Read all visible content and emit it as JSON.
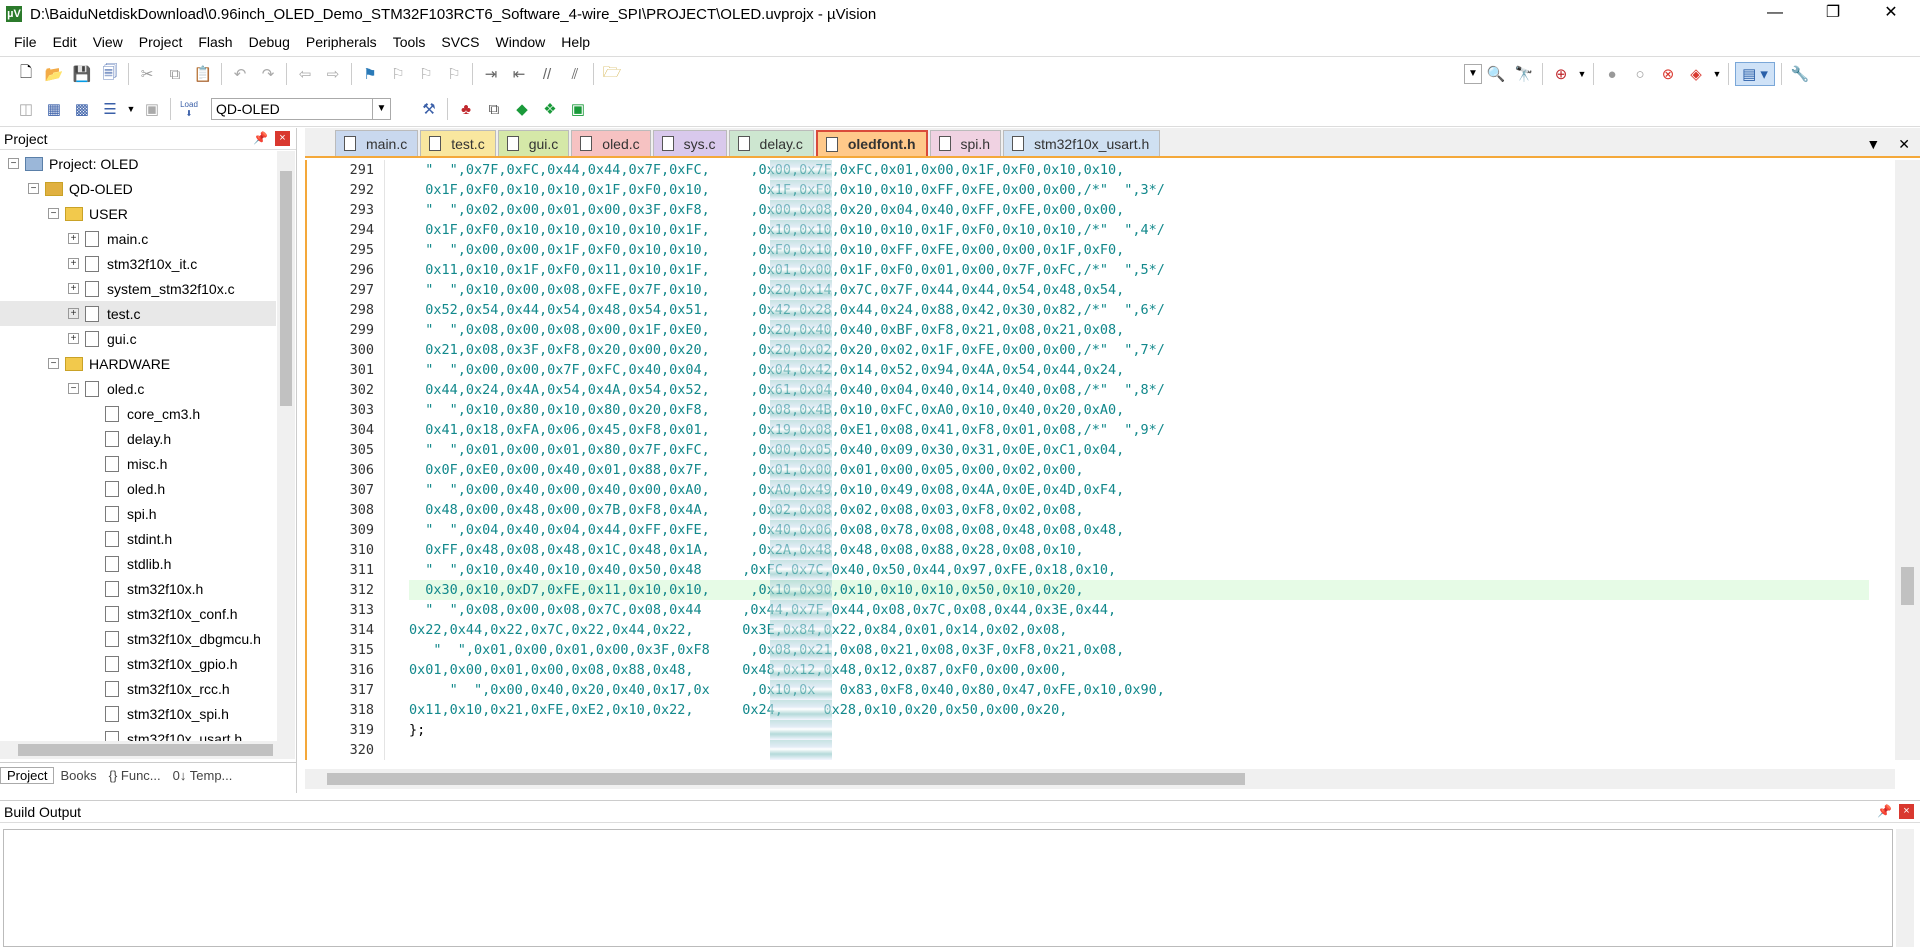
{
  "window": {
    "title": "D:\\BaiduNetdiskDownload\\0.96inch_OLED_Demo_STM32F103RCT6_Software_4-wire_SPI\\PROJECT\\OLED.uvprojx - µVision",
    "icon": "µV",
    "minimize": "—",
    "restore": "❐",
    "close": "✕"
  },
  "menu": [
    "File",
    "Edit",
    "View",
    "Project",
    "Flash",
    "Debug",
    "Peripherals",
    "Tools",
    "SVCS",
    "Window",
    "Help"
  ],
  "toolbar": {
    "target": "QD-OLED",
    "load_label": "Load"
  },
  "project_panel": {
    "title": "Project",
    "pin": "📌",
    "close": "×",
    "tree": [
      {
        "label": "Project: OLED",
        "level": 0,
        "kind": "root",
        "exp": "−"
      },
      {
        "label": "QD-OLED",
        "level": 1,
        "kind": "target",
        "exp": "−"
      },
      {
        "label": "USER",
        "level": 2,
        "kind": "folder",
        "exp": "−"
      },
      {
        "label": "main.c",
        "level": 3,
        "kind": "file",
        "exp": "+"
      },
      {
        "label": "stm32f10x_it.c",
        "level": 3,
        "kind": "file",
        "exp": "+"
      },
      {
        "label": "system_stm32f10x.c",
        "level": 3,
        "kind": "file",
        "exp": "+"
      },
      {
        "label": "test.c",
        "level": 3,
        "kind": "file",
        "exp": "+",
        "selected": true
      },
      {
        "label": "gui.c",
        "level": 3,
        "kind": "file",
        "exp": "+"
      },
      {
        "label": "HARDWARE",
        "level": 2,
        "kind": "folder",
        "exp": "−"
      },
      {
        "label": "oled.c",
        "level": 3,
        "kind": "file",
        "exp": "−"
      },
      {
        "label": "core_cm3.h",
        "level": 4,
        "kind": "file"
      },
      {
        "label": "delay.h",
        "level": 4,
        "kind": "file"
      },
      {
        "label": "misc.h",
        "level": 4,
        "kind": "file"
      },
      {
        "label": "oled.h",
        "level": 4,
        "kind": "file"
      },
      {
        "label": "spi.h",
        "level": 4,
        "kind": "file"
      },
      {
        "label": "stdint.h",
        "level": 4,
        "kind": "file"
      },
      {
        "label": "stdlib.h",
        "level": 4,
        "kind": "file"
      },
      {
        "label": "stm32f10x.h",
        "level": 4,
        "kind": "file"
      },
      {
        "label": "stm32f10x_conf.h",
        "level": 4,
        "kind": "file"
      },
      {
        "label": "stm32f10x_dbgmcu.h",
        "level": 4,
        "kind": "file"
      },
      {
        "label": "stm32f10x_gpio.h",
        "level": 4,
        "kind": "file"
      },
      {
        "label": "stm32f10x_rcc.h",
        "level": 4,
        "kind": "file"
      },
      {
        "label": "stm32f10x_spi.h",
        "level": 4,
        "kind": "file"
      },
      {
        "label": "stm32f10x_usart.h",
        "level": 4,
        "kind": "file"
      }
    ],
    "bottom_tabs": [
      "Project",
      "Books",
      "{} Func...",
      "0↓ Temp..."
    ]
  },
  "editor": {
    "tabs": [
      {
        "label": "main.c",
        "color": "#c9d8ee"
      },
      {
        "label": "test.c",
        "color": "#f9e79f"
      },
      {
        "label": "gui.c",
        "color": "#d5e8a8"
      },
      {
        "label": "oled.c",
        "color": "#f6c2c2"
      },
      {
        "label": "sys.c",
        "color": "#d9c9ec"
      },
      {
        "label": "delay.c",
        "color": "#cde6d0"
      },
      {
        "label": "oledfont.h",
        "color": "#ffc98a",
        "active": true
      },
      {
        "label": "spi.h",
        "color": "#f0d2e2"
      },
      {
        "label": "stm32f10x_usart.h",
        "color": "#cfe0f2"
      }
    ],
    "tab_controls": [
      "▼",
      "✕"
    ],
    "highlighted_line": "312",
    "lines": [
      {
        "n": "291",
        "t": "  \"  \",0x7F,0xFC,0x44,0x44,0x7F,0xFC,     ,0x00,0x7F,0xFC,0x01,0x00,0x1F,0xF0,0x10,0x10,"
      },
      {
        "n": "292",
        "t": "  0x1F,0xF0,0x10,0x10,0x1F,0xF0,0x10,      0x1F,0xF0,0x10,0x10,0xFF,0xFE,0x00,0x00,/*\"  \",3*/"
      },
      {
        "n": "293",
        "t": "  \"  \",0x02,0x00,0x01,0x00,0x3F,0xF8,     ,0x00,0x08,0x20,0x04,0x40,0xFF,0xFE,0x00,0x00,"
      },
      {
        "n": "294",
        "t": "  0x1F,0xF0,0x10,0x10,0x10,0x10,0x1F,     ,0x10,0x10,0x10,0x10,0x1F,0xF0,0x10,0x10,/*\"  \",4*/"
      },
      {
        "n": "295",
        "t": "  \"  \",0x00,0x00,0x1F,0xF0,0x10,0x10,     ,0xF0,0x10,0x10,0xFF,0xFE,0x00,0x00,0x1F,0xF0,"
      },
      {
        "n": "296",
        "t": "  0x11,0x10,0x1F,0xF0,0x11,0x10,0x1F,     ,0x01,0x00,0x1F,0xF0,0x01,0x00,0x7F,0xFC,/*\"  \",5*/"
      },
      {
        "n": "297",
        "t": "  \"  \",0x10,0x00,0x08,0xFE,0x7F,0x10,     ,0x20,0x14,0x7C,0x7F,0x44,0x44,0x54,0x48,0x54,"
      },
      {
        "n": "298",
        "t": "  0x52,0x54,0x44,0x54,0x48,0x54,0x51,     ,0x42,0x28,0x44,0x24,0x88,0x42,0x30,0x82,/*\"  \",6*/"
      },
      {
        "n": "299",
        "t": "  \"  \",0x08,0x00,0x08,0x00,0x1F,0xE0,     ,0x20,0x40,0x40,0xBF,0xF8,0x21,0x08,0x21,0x08,"
      },
      {
        "n": "300",
        "t": "  0x21,0x08,0x3F,0xF8,0x20,0x00,0x20,     ,0x20,0x02,0x20,0x02,0x1F,0xFE,0x00,0x00,/*\"  \",7*/"
      },
      {
        "n": "301",
        "t": "  \"  \",0x00,0x00,0x7F,0xFC,0x40,0x04,     ,0x04,0x42,0x14,0x52,0x94,0x4A,0x54,0x44,0x24,"
      },
      {
        "n": "302",
        "t": "  0x44,0x24,0x4A,0x54,0x4A,0x54,0x52,     ,0x61,0x04,0x40,0x04,0x40,0x14,0x40,0x08,/*\"  \",8*/"
      },
      {
        "n": "303",
        "t": "  \"  \",0x10,0x80,0x10,0x80,0x20,0xF8,     ,0x08,0x4B,0x10,0xFC,0xA0,0x10,0x40,0x20,0xA0,"
      },
      {
        "n": "304",
        "t": "  0x41,0x18,0xFA,0x06,0x45,0xF8,0x01,     ,0x19,0x08,0xE1,0x08,0x41,0xF8,0x01,0x08,/*\"  \",9*/"
      },
      {
        "n": "305",
        "t": "  \"  \",0x01,0x00,0x01,0x80,0x7F,0xFC,     ,0x00,0x05,0x40,0x09,0x30,0x31,0x0E,0xC1,0x04,"
      },
      {
        "n": "306",
        "t": "  0x0F,0xE0,0x00,0x40,0x01,0x88,0x7F,     ,0x01,0x00,0x01,0x00,0x05,0x00,0x02,0x00,"
      },
      {
        "n": "307",
        "t": "  \"  \",0x00,0x40,0x00,0x40,0x00,0xA0,     ,0xA0,0x49,0x10,0x49,0x08,0x4A,0x0E,0x4D,0xF4,"
      },
      {
        "n": "308",
        "t": "  0x48,0x00,0x48,0x00,0x7B,0xF8,0x4A,     ,0x02,0x08,0x02,0x08,0x03,0xF8,0x02,0x08,"
      },
      {
        "n": "309",
        "t": "  \"  \",0x04,0x40,0x04,0x44,0xFF,0xFE,     ,0x40,0x06,0x08,0x78,0x08,0x08,0x48,0x08,0x48,"
      },
      {
        "n": "310",
        "t": "  0xFF,0x48,0x08,0x48,0x1C,0x48,0x1A,     ,0x2A,0x48,0x48,0x08,0x88,0x28,0x08,0x10,"
      },
      {
        "n": "311",
        "t": "  \"  \",0x10,0x40,0x10,0x40,0x50,0x48     ,0xFC,0x7C,0x40,0x50,0x44,0x97,0xFE,0x18,0x10,"
      },
      {
        "n": "312",
        "t": "  0x30,0x10,0xD7,0xFE,0x11,0x10,0x10,     ,0x10,0x90,0x10,0x10,0x10,0x50,0x10,0x20,"
      },
      {
        "n": "313",
        "t": "  \"  \",0x08,0x00,0x08,0x7C,0x08,0x44     ,0x44,0x7F,0x44,0x08,0x7C,0x08,0x44,0x3E,0x44,"
      },
      {
        "n": "314",
        "t": "0x22,0x44,0x22,0x7C,0x22,0x44,0x22,      0x3E,0x84,0x22,0x84,0x01,0x14,0x02,0x08,"
      },
      {
        "n": "315",
        "t": "   \"  \",0x01,0x00,0x01,0x00,0x3F,0xF8     ,0x08,0x21,0x08,0x21,0x08,0x3F,0xF8,0x21,0x08,"
      },
      {
        "n": "316",
        "t": "0x01,0x00,0x01,0x00,0x08,0x88,0x48,      0x48,0x12,0x48,0x12,0x87,0xF0,0x00,0x00,"
      },
      {
        "n": "317",
        "t": "     \"  \",0x00,0x40,0x20,0x40,0x17,0x     ,0x10,0x   0x83,0xF8,0x40,0x80,0x47,0xFE,0x10,0x90,"
      },
      {
        "n": "318",
        "t": "0x11,0x10,0x21,0xFE,0xE2,0x10,0x22,      0x24,     0x28,0x10,0x20,0x50,0x00,0x20,"
      },
      {
        "n": "319",
        "t": "};"
      },
      {
        "n": "320",
        "t": ""
      }
    ]
  },
  "build_output": {
    "title": "Build Output",
    "pin": "📌",
    "close": "×"
  }
}
